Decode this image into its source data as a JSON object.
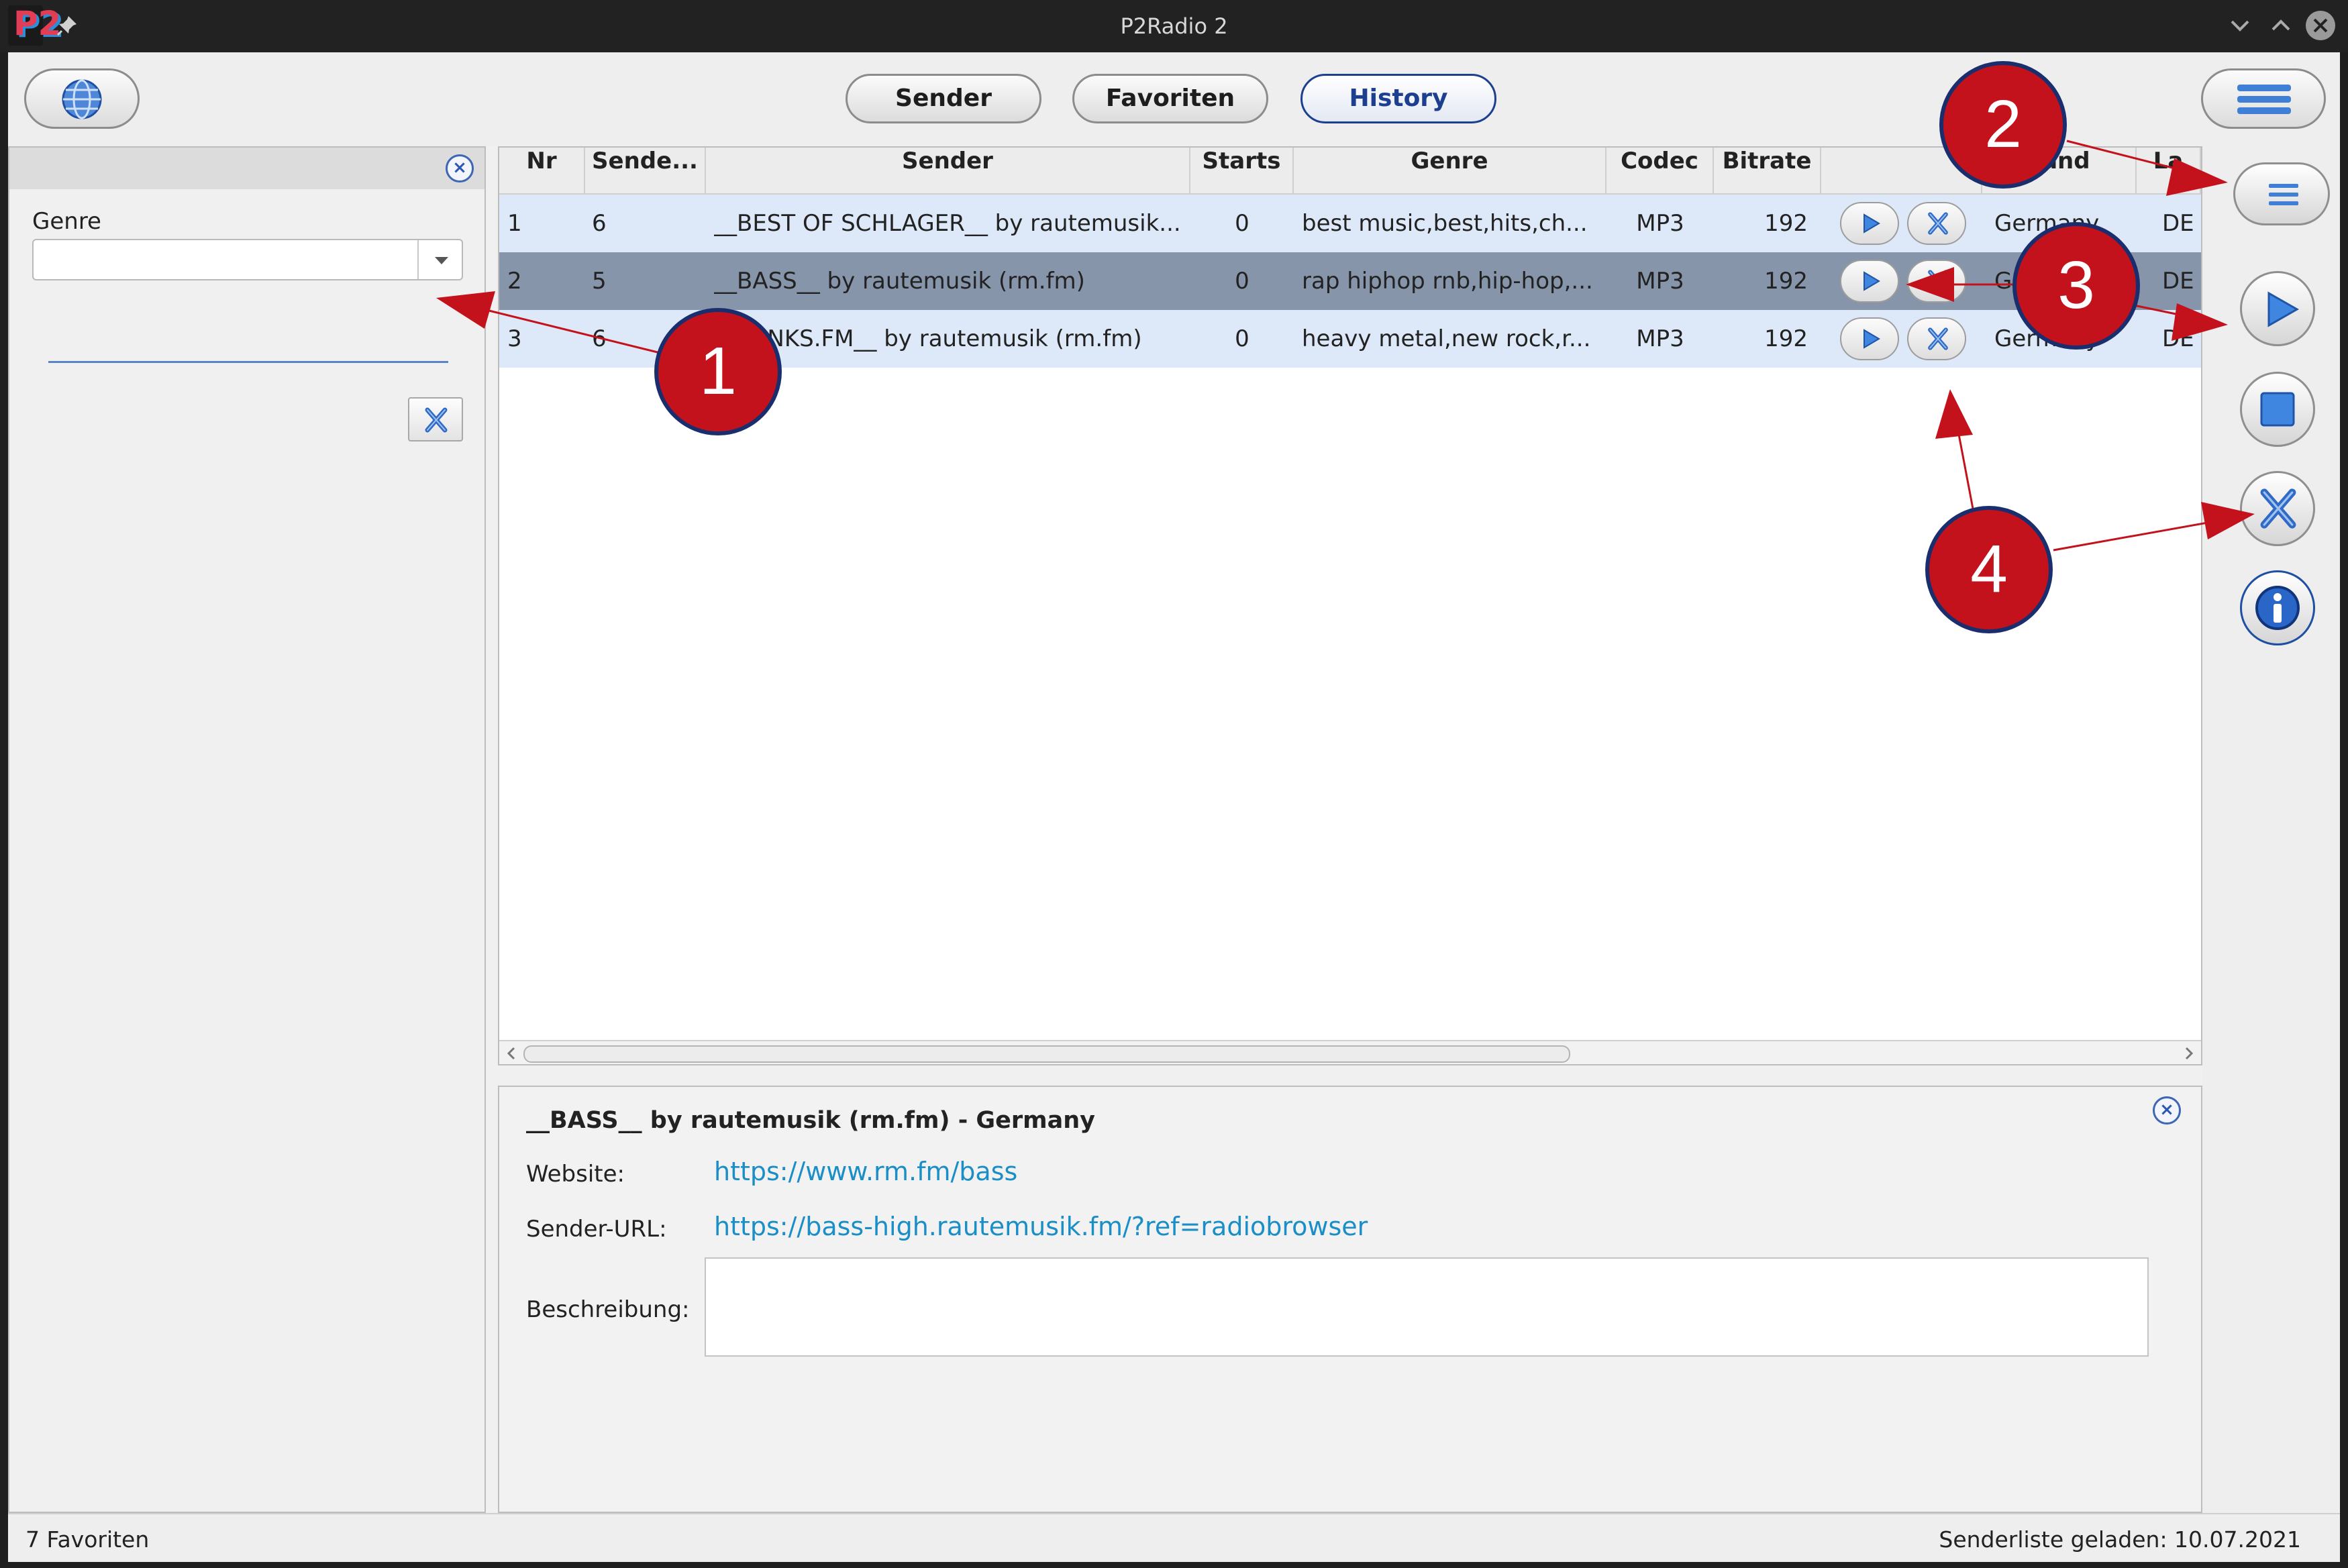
{
  "window": {
    "title": "P2Radio 2",
    "logo_text": "P2"
  },
  "toolbar": {
    "tabs": [
      {
        "label": "Sender",
        "active": false
      },
      {
        "label": "Favoriten",
        "active": false
      },
      {
        "label": "History",
        "active": true
      }
    ]
  },
  "filter_panel": {
    "genre_label": "Genre",
    "genre_value": ""
  },
  "table": {
    "columns": [
      "Nr",
      "Sende...",
      "Sender",
      "Starts",
      "Genre",
      "Codec",
      "Bitrate",
      "",
      "Land",
      "La"
    ],
    "rows": [
      {
        "nr": "1",
        "sende": "6",
        "sender": "__BEST OF SCHLAGER__ by rautemusik...",
        "starts": "0",
        "genre": "best music,best,hits,ch...",
        "codec": "MP3",
        "bitrate": "192",
        "land": "Germany",
        "la": "DE",
        "selected": false
      },
      {
        "nr": "2",
        "sende": "5",
        "sender": "__BASS__ by rautemusik (rm.fm)",
        "starts": "0",
        "genre": "rap hiphop rnb,hip-hop,...",
        "codec": "MP3",
        "bitrate": "192",
        "land": "Germany",
        "la": "DE",
        "selected": true
      },
      {
        "nr": "3",
        "sende": "6",
        "sender": "__PUNKS.FM__ by rautemusik (rm.fm)",
        "starts": "0",
        "genre": "heavy metal,new rock,r...",
        "codec": "MP3",
        "bitrate": "192",
        "land": "Germany",
        "la": "DE",
        "selected": false
      }
    ]
  },
  "detail": {
    "title": "__BASS__ by rautemusik (rm.fm)  -  Germany",
    "website_label": "Website:",
    "website_url": "https://www.rm.fm/bass",
    "stream_label": "Sender-URL:",
    "stream_url": "https://bass-high.rautemusik.fm/?ref=radiobrowser",
    "description_label": "Beschreibung:",
    "description": ""
  },
  "statusbar": {
    "left": "7 Favoriten",
    "right": "Senderliste geladen: 10.07.2021"
  },
  "annotations": [
    "1",
    "2",
    "3",
    "4"
  ],
  "colors": {
    "accent": "#1d3f8f",
    "selected_row": "#8795ab",
    "alt_row": "#dde9f8",
    "link": "#1a8ec6",
    "callout": "#c4121c"
  },
  "icons": [
    "pin-icon",
    "globe-icon",
    "hamburger-menu-icon",
    "play-icon",
    "stop-icon",
    "delete-x-icon",
    "info-icon",
    "close-icon",
    "minimize-icon",
    "maximize-icon"
  ]
}
